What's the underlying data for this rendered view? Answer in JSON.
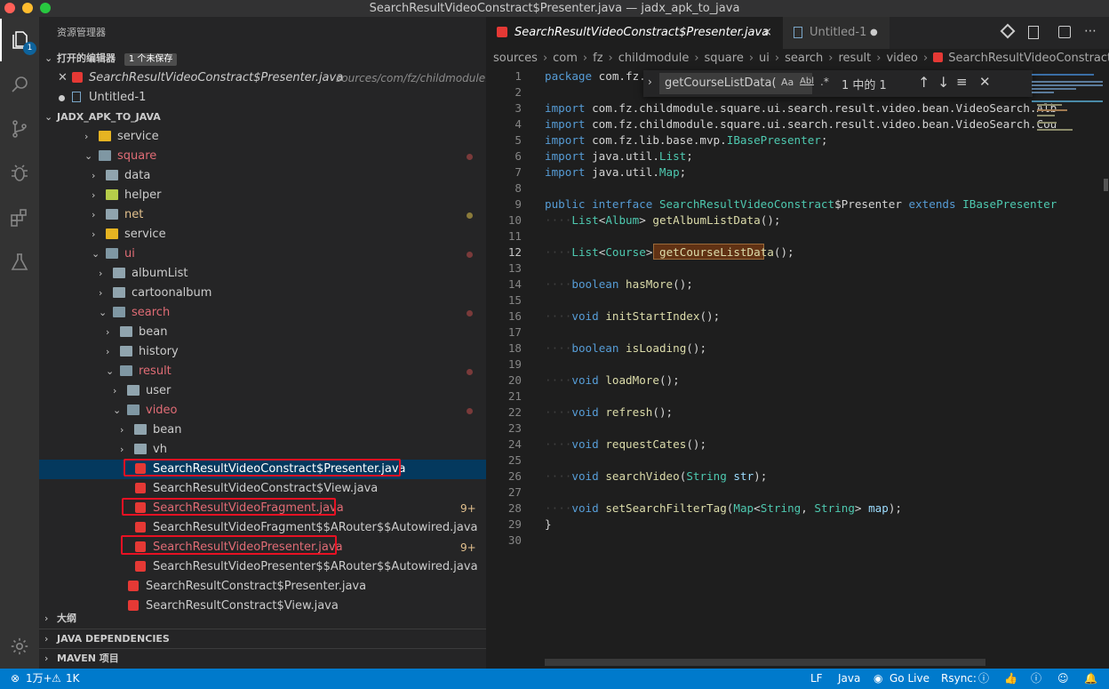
{
  "window": {
    "title": "SearchResultVideoConstract$Presenter.java — jadx_apk_to_java",
    "colors": {
      "close": "#ff5f57",
      "minimize": "#febc2e",
      "zoom": "#28c840"
    }
  },
  "activity": {
    "items": [
      "explorer-icon",
      "search-icon",
      "source-control-icon",
      "debug-icon",
      "extensions-icon",
      "testing-icon",
      "gear-icon"
    ],
    "explorer_badge": "1"
  },
  "sidebar": {
    "title": "资源管理器",
    "open_editors": {
      "label": "打开的编辑器",
      "badge": "1 个未保存",
      "items": [
        {
          "name": "SearchResultVideoConstract$Presenter.java",
          "path": "sources/com/fz/childmodule..."
        },
        {
          "name": "Untitled-1"
        }
      ]
    },
    "project": {
      "label": "JADX_APK_TO_JAVA"
    },
    "tree": [
      {
        "label": "service",
        "chev": "›"
      },
      {
        "label": "square",
        "chev": "⌄"
      },
      {
        "label": "data",
        "chev": "›"
      },
      {
        "label": "helper",
        "chev": "›"
      },
      {
        "label": "net",
        "chev": "›"
      },
      {
        "label": "service",
        "chev": "›"
      },
      {
        "label": "ui",
        "chev": "⌄"
      },
      {
        "label": "albumList",
        "chev": "›"
      },
      {
        "label": "cartoonalbum",
        "chev": "›"
      },
      {
        "label": "search",
        "chev": "⌄"
      },
      {
        "label": "bean",
        "chev": "›"
      },
      {
        "label": "history",
        "chev": "›"
      },
      {
        "label": "result",
        "chev": "⌄"
      },
      {
        "label": "user",
        "chev": "›"
      },
      {
        "label": "video",
        "chev": "⌄"
      },
      {
        "label": "bean",
        "chev": "›"
      },
      {
        "label": "vh",
        "chev": "›"
      },
      {
        "label": "SearchResultVideoConstract$Presenter.java"
      },
      {
        "label": "SearchResultVideoConstract$View.java"
      },
      {
        "label": "SearchResultVideoFragment.java",
        "count": "9+"
      },
      {
        "label": "SearchResultVideoFragment$$ARouter$$Autowired.java"
      },
      {
        "label": "SearchResultVideoPresenter.java",
        "count": "9+"
      },
      {
        "label": "SearchResultVideoPresenter$$ARouter$$Autowired.java"
      },
      {
        "label": "SearchResultConstract$Presenter.java"
      },
      {
        "label": "SearchResultConstract$View.java"
      }
    ],
    "sections": [
      "大纲",
      "JAVA DEPENDENCIES",
      "MAVEN 项目"
    ]
  },
  "editor": {
    "tabs": [
      {
        "label": "SearchResultVideoConstract$Presenter.java",
        "close": "×"
      },
      {
        "label": "Untitled-1",
        "dirty": "●"
      }
    ],
    "breadcrumbs": [
      "sources",
      "com",
      "fz",
      "childmodule",
      "square",
      "ui",
      "search",
      "result",
      "video",
      "SearchResultVideoConstract$Pres"
    ],
    "find": {
      "value": "getCourseListData(",
      "result": "1 中的 1",
      "case": "Aa",
      "word": "Abl",
      "regex": ".*"
    },
    "line_numbers": [
      "1",
      "2",
      "3",
      "4",
      "5",
      "6",
      "7",
      "8",
      "9",
      "10",
      "11",
      "12",
      "13",
      "14",
      "15",
      "16",
      "17",
      "18",
      "19",
      "20",
      "21",
      "22",
      "23",
      "24",
      "25",
      "26",
      "27",
      "28",
      "29",
      "30"
    ],
    "current_line": "12",
    "code": [
      "package com.fz.c",
      "",
      "import com.fz.childmodule.square.ui.search.result.video.bean.VideoSearch.Alb",
      "import com.fz.childmodule.square.ui.search.result.video.bean.VideoSearch.Cou",
      "import com.fz.lib.base.mvp.IBasePresenter;",
      "import java.util.List;",
      "import java.util.Map;",
      "",
      "public interface SearchResultVideoConstract$Presenter extends IBasePresenter",
      "    List<Album> getAlbumListData();",
      "",
      "    List<Course> getCourseListData();",
      "",
      "    boolean hasMore();",
      "",
      "    void initStartIndex();",
      "",
      "    boolean isLoading();",
      "",
      "    void loadMore();",
      "",
      "    void refresh();",
      "",
      "    void requestCates();",
      "",
      "    void searchVideo(String str);",
      "",
      "    void setSearchFilterTag(Map<String, String> map);",
      "}",
      ""
    ]
  },
  "status": {
    "errors": "1万+",
    "warnings": "1K",
    "eol": "LF",
    "lang": "Java",
    "golive": "Go Live",
    "rsync": "Rsync:"
  }
}
